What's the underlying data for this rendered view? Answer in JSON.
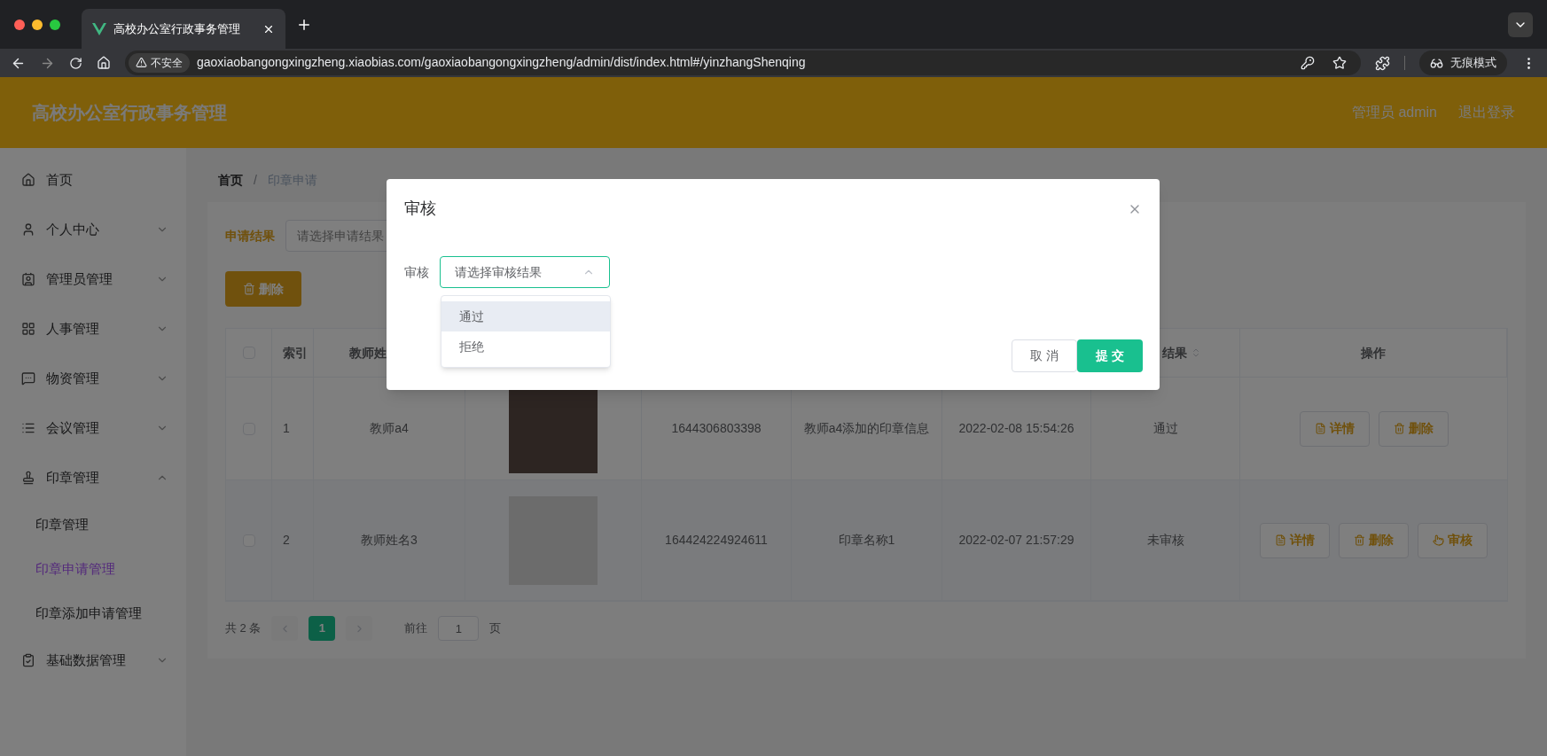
{
  "browser": {
    "tab_title": "高校办公室行政事务管理",
    "security_label": "不安全",
    "url": "gaoxiaobangongxingzheng.xiaobias.com/gaoxiaobangongxingzheng/admin/dist/index.html#/yinzhangShenqing",
    "incognito_label": "无痕模式"
  },
  "header": {
    "title": "高校办公室行政事务管理",
    "user": "管理员 admin",
    "logout": "退出登录"
  },
  "sidebar": {
    "items": [
      {
        "label": "首页"
      },
      {
        "label": "个人中心",
        "expanded": false
      },
      {
        "label": "管理员管理",
        "expanded": false
      },
      {
        "label": "人事管理",
        "expanded": false
      },
      {
        "label": "物资管理",
        "expanded": false
      },
      {
        "label": "会议管理",
        "expanded": false
      },
      {
        "label": "印章管理",
        "expanded": true,
        "children": [
          {
            "label": "印章管理",
            "selected": false
          },
          {
            "label": "印章申请管理",
            "selected": true
          },
          {
            "label": "印章添加申请管理",
            "selected": false
          }
        ]
      },
      {
        "label": "基础数据管理",
        "expanded": false
      }
    ]
  },
  "breadcrumb": {
    "separator": "/",
    "items": [
      "首页",
      "印章申请"
    ]
  },
  "filter": {
    "label": "申请结果",
    "placeholder": "请选择申请结果"
  },
  "delete_button": "删除",
  "table": {
    "columns": [
      {
        "kind": "checkbox",
        "checked": false
      },
      {
        "label": "索引"
      },
      {
        "label": "教师姓"
      },
      {},
      {},
      {},
      {},
      {
        "label": "结果",
        "sortable": true
      },
      {
        "label": "操作"
      }
    ],
    "rows": [
      {
        "checked": false,
        "hovered": false,
        "index": "1",
        "teacher": "教师a4",
        "number": "1644306803398",
        "name": "教师a4添加的印章信息",
        "date": "2022-02-08 15:54:26",
        "result": "通过",
        "actions": [
          {
            "kind": "detail",
            "label": "详情"
          },
          {
            "kind": "delete",
            "label": "删除"
          }
        ]
      },
      {
        "checked": false,
        "hovered": true,
        "index": "2",
        "teacher": "教师姓名3",
        "number": "164424224924611",
        "name": "印章名称1",
        "date": "2022-02-07 21:57:29",
        "result": "未审核",
        "actions": [
          {
            "kind": "detail",
            "label": "详情"
          },
          {
            "kind": "delete",
            "label": "删除"
          },
          {
            "kind": "review",
            "label": "审核"
          }
        ]
      }
    ]
  },
  "pagination": {
    "total": "共 2 条",
    "pages": [
      {
        "label": "1",
        "selected": true
      }
    ],
    "goto_label": "前往",
    "goto_value": "1",
    "page_suffix": "页"
  },
  "modal": {
    "title": "审核",
    "field_label": "审核",
    "select_placeholder": "请选择审核结果",
    "options": [
      {
        "label": "通过",
        "hovered": true
      },
      {
        "label": "拒绝",
        "hovered": false
      }
    ],
    "cancel": "取 消",
    "submit": "提 交"
  }
}
